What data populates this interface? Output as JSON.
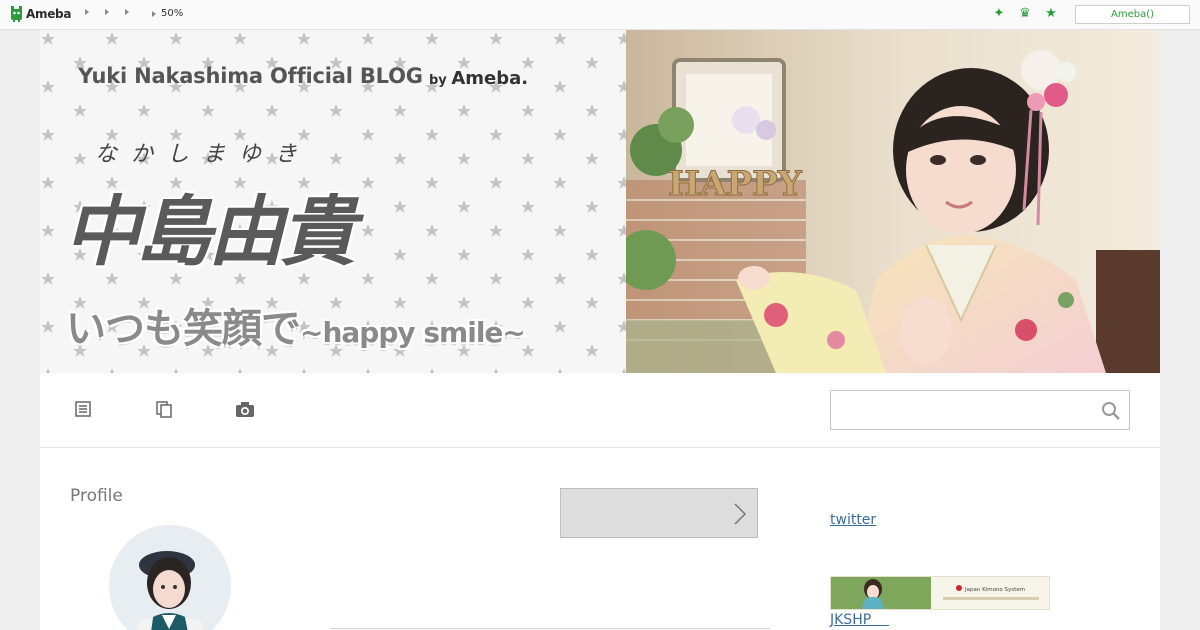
{
  "topbar": {
    "brand": "Ameba",
    "zoom": "50%",
    "ameba_button": "Ameba()",
    "icons": [
      "sparkle-icon",
      "crown-icon",
      "star-icon"
    ],
    "accent": "#2a9d3a"
  },
  "header": {
    "blog_title": "Yuki Nakashima Official BLOG",
    "byline_prefix": "by",
    "byline_brand": "Ameba.",
    "ruby": "なかしまゆき",
    "name_kanji": "中島由貴",
    "tagline_jp": "いつも笑顔で",
    "tagline_en": "~happy smile~",
    "photo_sign": "HAPPY"
  },
  "nav": {
    "icons": [
      "article-list-icon",
      "copy-pages-icon",
      "camera-icon"
    ],
    "search_placeholder": ""
  },
  "profile": {
    "title": "Profile"
  },
  "sidebar": {
    "twitter_label": "twitter",
    "jkshp_label": "JKSHP    ",
    "jkshp_banner_brand": "Japan Kimono System"
  }
}
